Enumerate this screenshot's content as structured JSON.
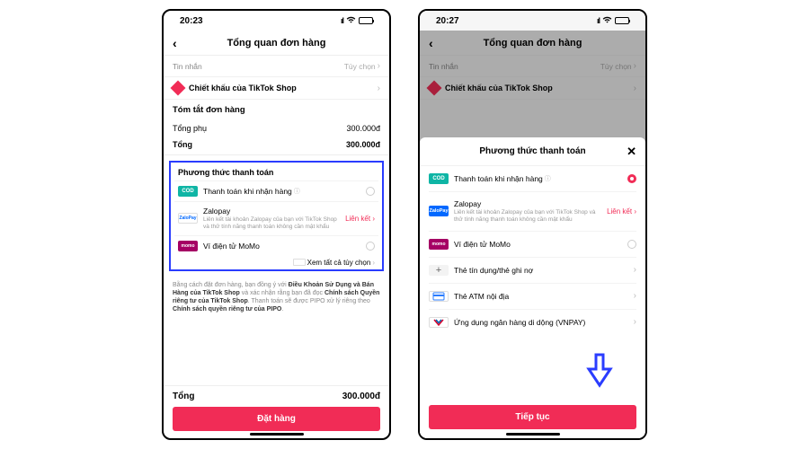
{
  "screen1": {
    "status_time": "20:23",
    "nav_title": "Tổng quan đơn hàng",
    "message_label": "Tin nhắn",
    "message_value": "Tùy chọn",
    "discount_label": "Chiết khấu của TikTok Shop",
    "summary_title": "Tóm tắt đơn hàng",
    "subtotal_label": "Tổng phụ",
    "subtotal_value": "300.000đ",
    "total_label": "Tổng",
    "total_value": "300.000đ",
    "payment_title": "Phương thức thanh toán",
    "pm_cod": "Thanh toán khi nhận hàng",
    "pm_zalo": "Zalopay",
    "pm_zalo_link": "Liên kết",
    "pm_zalo_desc": "Liên kết tài khoản Zalopay của bạn với TikTok Shop và thử tính năng thanh toán không cần mật khẩu",
    "pm_momo": "Ví điện tử MoMo",
    "pm_viewall": "Xem tất cả tùy chọn",
    "terms_html": "Bằng cách đặt đơn hàng, bạn đồng ý với <b>Điều Khoản Sử Dụng và Bán Hàng của TikTok Shop</b> và xác nhận rằng bạn đã đọc <b>Chính sách Quyền riêng tư của TikTok Shop</b>. Thanh toán sẽ được PIPO xử lý riêng theo <b>Chính sách quyền riêng tư của PIPO</b>.",
    "bottom_total_label": "Tổng",
    "bottom_total_value": "300.000đ",
    "cta": "Đặt hàng"
  },
  "screen2": {
    "status_time": "20:27",
    "nav_title": "Tổng quan đơn hàng",
    "message_label": "Tin nhắn",
    "message_value": "Tùy chọn",
    "discount_label": "Chiết khấu của TikTok Shop",
    "sheet_title": "Phương thức thanh toán",
    "pm_cod": "Thanh toán khi nhận hàng",
    "pm_zalo": "Zalopay",
    "pm_zalo_link": "Liên kết",
    "pm_zalo_desc": "Liên kết tài khoản Zalopay của bạn với TikTok Shop và thử tính năng thanh toán không cần mật khẩu",
    "pm_momo": "Ví điện tử MoMo",
    "pm_card": "Thẻ tín dụng/thẻ ghi nợ",
    "pm_atm": "Thẻ ATM nội địa",
    "pm_vnpay": "Ứng dụng ngân hàng di dộng (VNPAY)",
    "cta": "Tiếp tục"
  },
  "icons": {
    "cod": "COD",
    "zalo": "ZaloPay",
    "momo": "momo"
  }
}
